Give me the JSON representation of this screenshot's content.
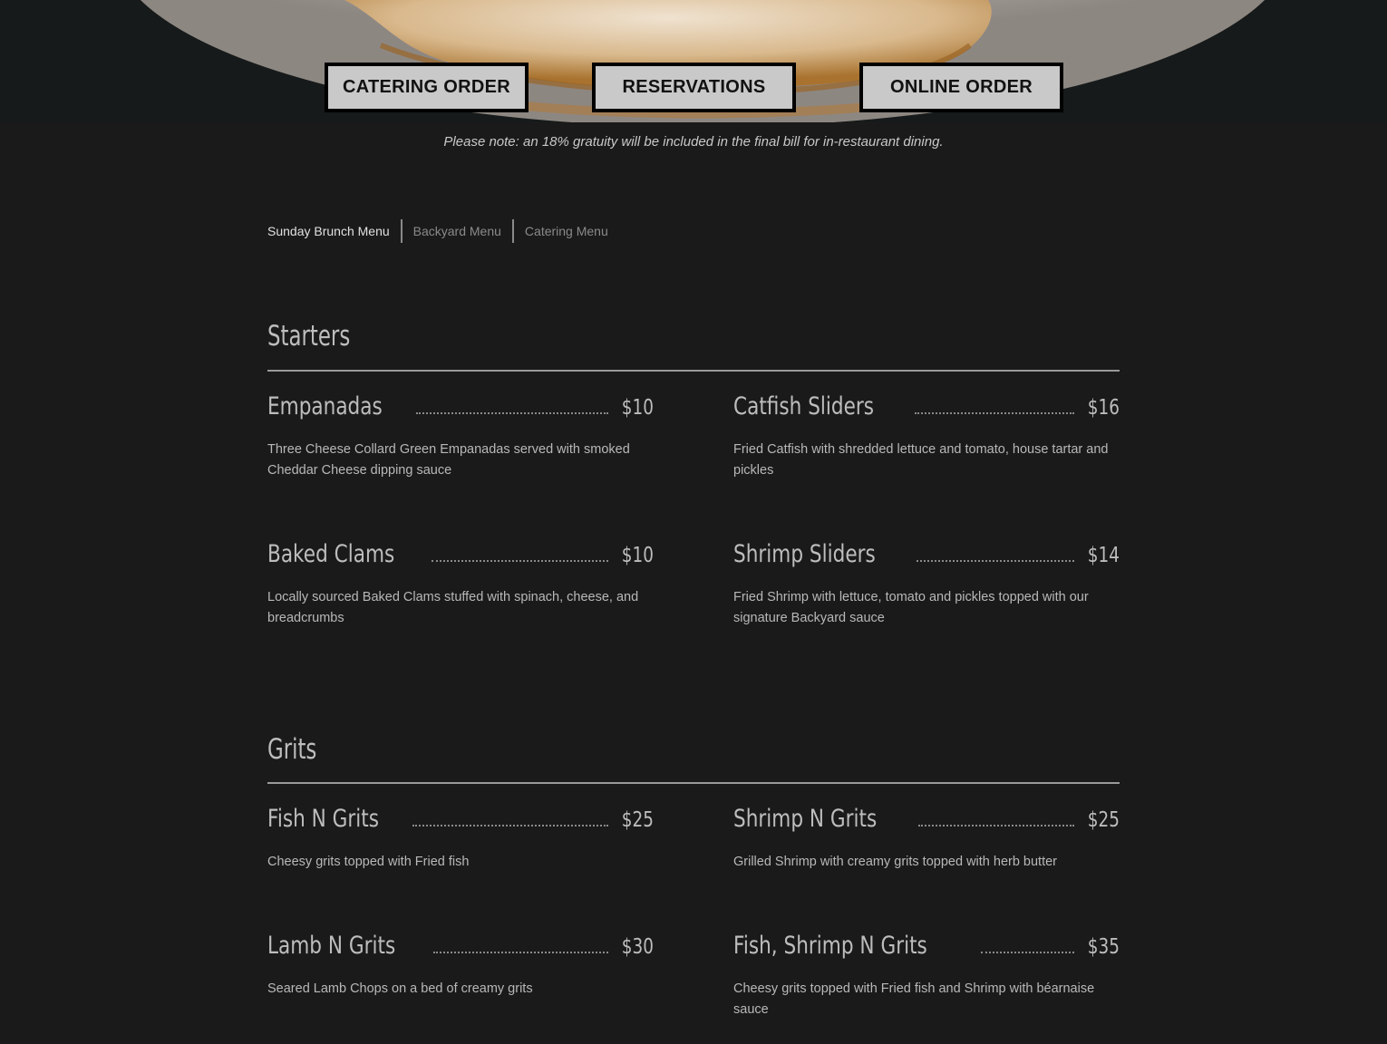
{
  "hero": {
    "buttons": {
      "catering": "CATERING ORDER",
      "reservations": "RESERVATIONS",
      "online": "ONLINE ORDER"
    }
  },
  "note": "Please note: an 18% gratuity will be included in the final bill for in-restaurant dining.",
  "tabs": [
    "Sunday Brunch Menu",
    "Backyard Menu",
    "Catering Menu"
  ],
  "sections": [
    {
      "title": "Starters",
      "items": [
        {
          "name": "Empanadas",
          "price": "$10",
          "desc": "Three Cheese Collard Green Empanadas served with smoked Cheddar Cheese dipping sauce"
        },
        {
          "name": "Catfish Sliders",
          "price": "$16",
          "desc": "Fried Catfish with shredded lettuce and tomato, house tartar and pickles"
        },
        {
          "name": "Baked Clams",
          "price": "$10",
          "desc": "Locally sourced Baked Clams stuffed with spinach, cheese, and breadcrumbs"
        },
        {
          "name": "Shrimp Sliders",
          "price": "$14",
          "desc": "Fried Shrimp with lettuce, tomato and pickles topped with our signature Backyard sauce"
        }
      ]
    },
    {
      "title": "Grits",
      "items": [
        {
          "name": "Fish N Grits",
          "price": "$25",
          "desc": "Cheesy grits topped with Fried fish"
        },
        {
          "name": "Shrimp N Grits",
          "price": "$25",
          "desc": "Grilled Shrimp with creamy grits topped with herb butter"
        },
        {
          "name": "Lamb N Grits",
          "price": "$30",
          "desc": "Seared Lamb Chops on a bed of creamy grits"
        },
        {
          "name": "Fish, Shrimp N Grits",
          "price": "$35",
          "desc": "Cheesy grits topped with Fried fish and Shrimp with béarnaise sauce"
        }
      ]
    }
  ],
  "colors": {
    "background": "#1a1a1a",
    "button_bg": "#c9c9c9",
    "button_border": "#000000"
  }
}
